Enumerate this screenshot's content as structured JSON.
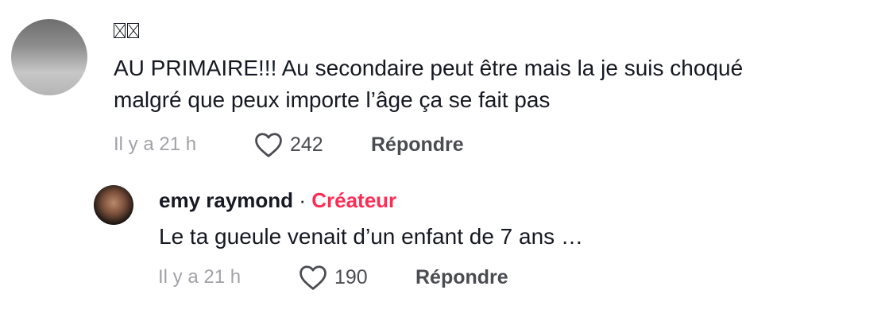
{
  "comment": {
    "author_glyphs": [
      "glyph-1",
      "glyph-2"
    ],
    "text_line1": "AU PRIMAIRE!!! Au secondaire peut être mais la je suis choqué",
    "text_line2": "malgré que peux importe l’âge ça se fait pas",
    "timestamp": "Il y a 21 h",
    "likes": "242",
    "reply_label": "Répondre"
  },
  "reply": {
    "author": "emy raymond",
    "separator": "·",
    "badge": "Créateur",
    "text": "Le ta gueule venait d’un enfant de 7 ans …",
    "timestamp": "Il y a 21 h",
    "likes": "190",
    "reply_label": "Répondre"
  },
  "colors": {
    "text": "#161823",
    "muted": "#a1a2a7",
    "action": "#4b4c52",
    "creator": "#fe2c55"
  },
  "icons": {
    "like": "heart-outline-icon"
  }
}
